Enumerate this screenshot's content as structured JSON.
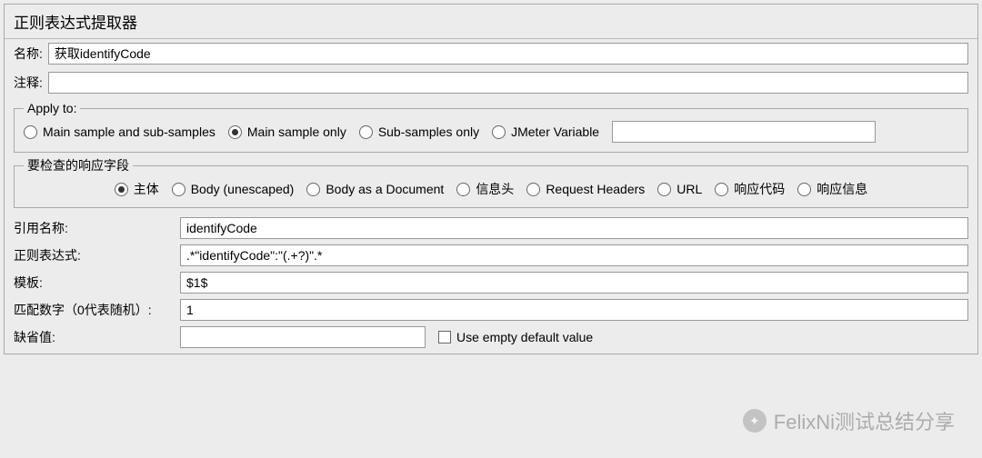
{
  "panel_title": "正则表达式提取器",
  "name_label": "名称:",
  "name_value": "获取identifyCode",
  "comment_label": "注释:",
  "comment_value": "",
  "apply_to": {
    "legend": "Apply to:",
    "options": {
      "main_and_sub": "Main sample and sub-samples",
      "main_only": "Main sample only",
      "sub_only": "Sub-samples only",
      "jmeter_var": "JMeter Variable"
    },
    "selected": "main_only",
    "jmeter_var_value": ""
  },
  "field_to_check": {
    "legend": "要检查的响应字段",
    "options": {
      "body": "主体",
      "body_unescaped": "Body (unescaped)",
      "body_document": "Body as a Document",
      "headers_cn": "信息头",
      "request_headers": "Request Headers",
      "url": "URL",
      "response_code": "响应代码",
      "response_message": "响应信息"
    },
    "selected": "body"
  },
  "fields": {
    "ref_name_label": "引用名称:",
    "ref_name_value": "identifyCode",
    "regex_label": "正则表达式:",
    "regex_value": ".*\"identifyCode\":\"(.+?)\".*",
    "template_label": "模板:",
    "template_value": "$1$",
    "match_no_label": "匹配数字（0代表随机）:",
    "match_no_value": "1",
    "default_label": "缺省值:",
    "default_value": "",
    "use_empty_label": "Use empty default value",
    "use_empty_checked": false
  },
  "watermark": "FelixNi测试总结分享"
}
